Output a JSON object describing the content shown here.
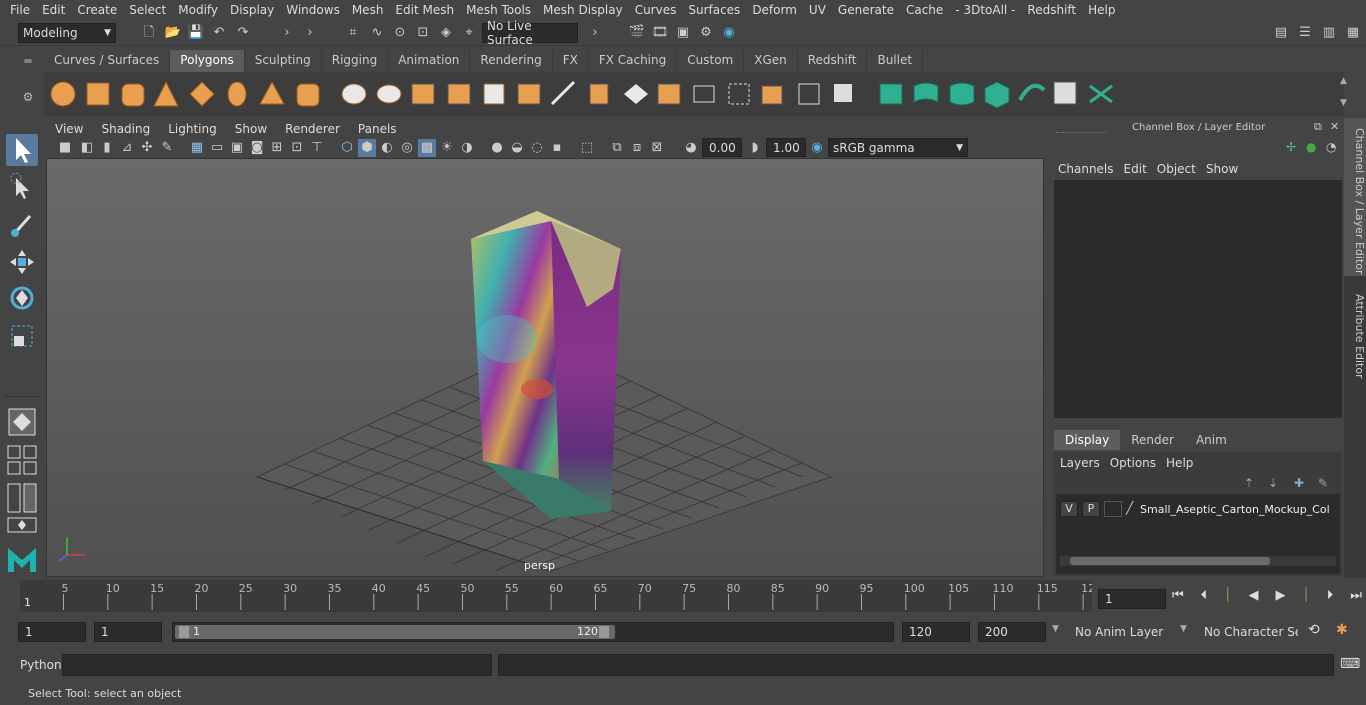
{
  "menubar": {
    "items": [
      "File",
      "Edit",
      "Create",
      "Select",
      "Modify",
      "Display",
      "Windows",
      "Mesh",
      "Edit Mesh",
      "Mesh Tools",
      "Mesh Display",
      "Curves",
      "Surfaces",
      "Deform",
      "UV",
      "Generate",
      "Cache",
      "- 3DtoAll -",
      "Redshift",
      "Help"
    ]
  },
  "statusline": {
    "mode": "Modeling",
    "live_surface": "No Live Surface"
  },
  "shelf": {
    "tabs": [
      "Curves / Surfaces",
      "Polygons",
      "Sculpting",
      "Rigging",
      "Animation",
      "Rendering",
      "FX",
      "FX Caching",
      "Custom",
      "XGen",
      "Redshift",
      "Bullet"
    ],
    "active_tab": "Polygons"
  },
  "viewport": {
    "menu": [
      "View",
      "Shading",
      "Lighting",
      "Show",
      "Renderer",
      "Panels"
    ],
    "exposure": "0.00",
    "gamma": "1.00",
    "colorspace": "sRGB gamma",
    "camera_label": "persp"
  },
  "channelbox": {
    "title": "Channel Box / Layer Editor",
    "menu": [
      "Channels",
      "Edit",
      "Object",
      "Show"
    ],
    "layer_tabs": [
      "Display",
      "Render",
      "Anim"
    ],
    "active_layer_tab": "Display",
    "layer_menu": [
      "Layers",
      "Options",
      "Help"
    ],
    "layer": {
      "v": "V",
      "p": "P",
      "name": "Small_Aseptic_Carton_Mockup_Color"
    }
  },
  "sidetabs": [
    "Channel Box / Layer Editor",
    "Attribute Editor"
  ],
  "timeline": {
    "ticks": [
      "5",
      "10",
      "15",
      "20",
      "25",
      "30",
      "35",
      "40",
      "45",
      "50",
      "55",
      "60",
      "65",
      "70",
      "75",
      "80",
      "85",
      "90",
      "95",
      "100",
      "105",
      "110",
      "115",
      "12"
    ],
    "start_marker": "1",
    "current_frame": "1"
  },
  "range": {
    "start": "1",
    "playback_start": "1",
    "slider_start": "1",
    "slider_end": "120",
    "playback_end": "120",
    "end": "200",
    "anim_layer": "No Anim Layer",
    "character_set": "No Character Set"
  },
  "cmdline": {
    "label": "Python"
  },
  "helpline": {
    "text": "Select Tool: select an object"
  }
}
